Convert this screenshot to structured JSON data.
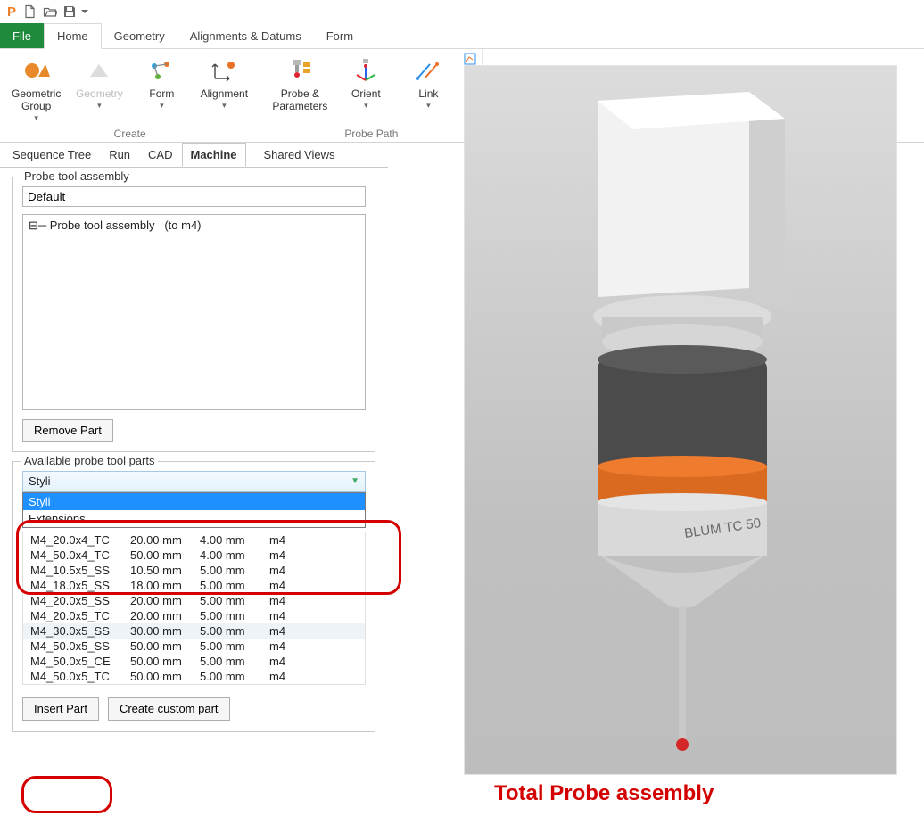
{
  "qat": {
    "logo_text": "P"
  },
  "ribbon_tabs": [
    "File",
    "Home",
    "Geometry",
    "Alignments & Datums",
    "Form"
  ],
  "ribbon_active_tab": "Home",
  "ribbon": {
    "create_group_label": "Create",
    "probe_group_label": "Probe Path",
    "buttons": {
      "geometric_group": "Geometric\nGroup",
      "geometry": "Geometry",
      "form": "Form",
      "alignment": "Alignment",
      "probe_params": "Probe &\nParameters",
      "orient": "Orient",
      "link": "Link"
    }
  },
  "panel_tabs": [
    "Sequence Tree",
    "Run",
    "CAD",
    "Machine",
    "Shared Views"
  ],
  "panel_active_tab": "Machine",
  "machine_panel": {
    "probe_tool_assembly_label": "Probe tool assembly",
    "assembly_name": "Default",
    "tree_root": "Probe tool assembly   (to m4)",
    "remove_part_label": "Remove Part",
    "available_label": "Available probe tool parts",
    "combo_display": "Styli",
    "combo_options": [
      "Styli",
      "Extensions"
    ],
    "combo_selected": "Styli",
    "parts": [
      {
        "name": "M4_20.0x4_TC",
        "len": "20.00 mm",
        "dia": "4.00 mm",
        "thr": "m4"
      },
      {
        "name": "M4_50.0x4_TC",
        "len": "50.00 mm",
        "dia": "4.00 mm",
        "thr": "m4"
      },
      {
        "name": "M4_10.5x5_SS",
        "len": "10.50 mm",
        "dia": "5.00 mm",
        "thr": "m4"
      },
      {
        "name": "M4_18.0x5_SS",
        "len": "18.00 mm",
        "dia": "5.00 mm",
        "thr": "m4"
      },
      {
        "name": "M4_20.0x5_SS",
        "len": "20.00 mm",
        "dia": "5.00 mm",
        "thr": "m4"
      },
      {
        "name": "M4_20.0x5_TC",
        "len": "20.00 mm",
        "dia": "5.00 mm",
        "thr": "m4"
      },
      {
        "name": "M4_30.0x5_SS",
        "len": "30.00 mm",
        "dia": "5.00 mm",
        "thr": "m4"
      },
      {
        "name": "M4_50.0x5_SS",
        "len": "50.00 mm",
        "dia": "5.00 mm",
        "thr": "m4"
      },
      {
        "name": "M4_50.0x5_CE",
        "len": "50.00 mm",
        "dia": "5.00 mm",
        "thr": "m4"
      },
      {
        "name": "M4_50.0x5_TC",
        "len": "50.00 mm",
        "dia": "5.00 mm",
        "thr": "m4"
      }
    ],
    "parts_selected_index": 6,
    "insert_part_label": "Insert Part",
    "create_custom_label": "Create custom part"
  },
  "viewport": {
    "probe_label": "BLUM TC 50"
  },
  "caption": "Total Probe assembly"
}
